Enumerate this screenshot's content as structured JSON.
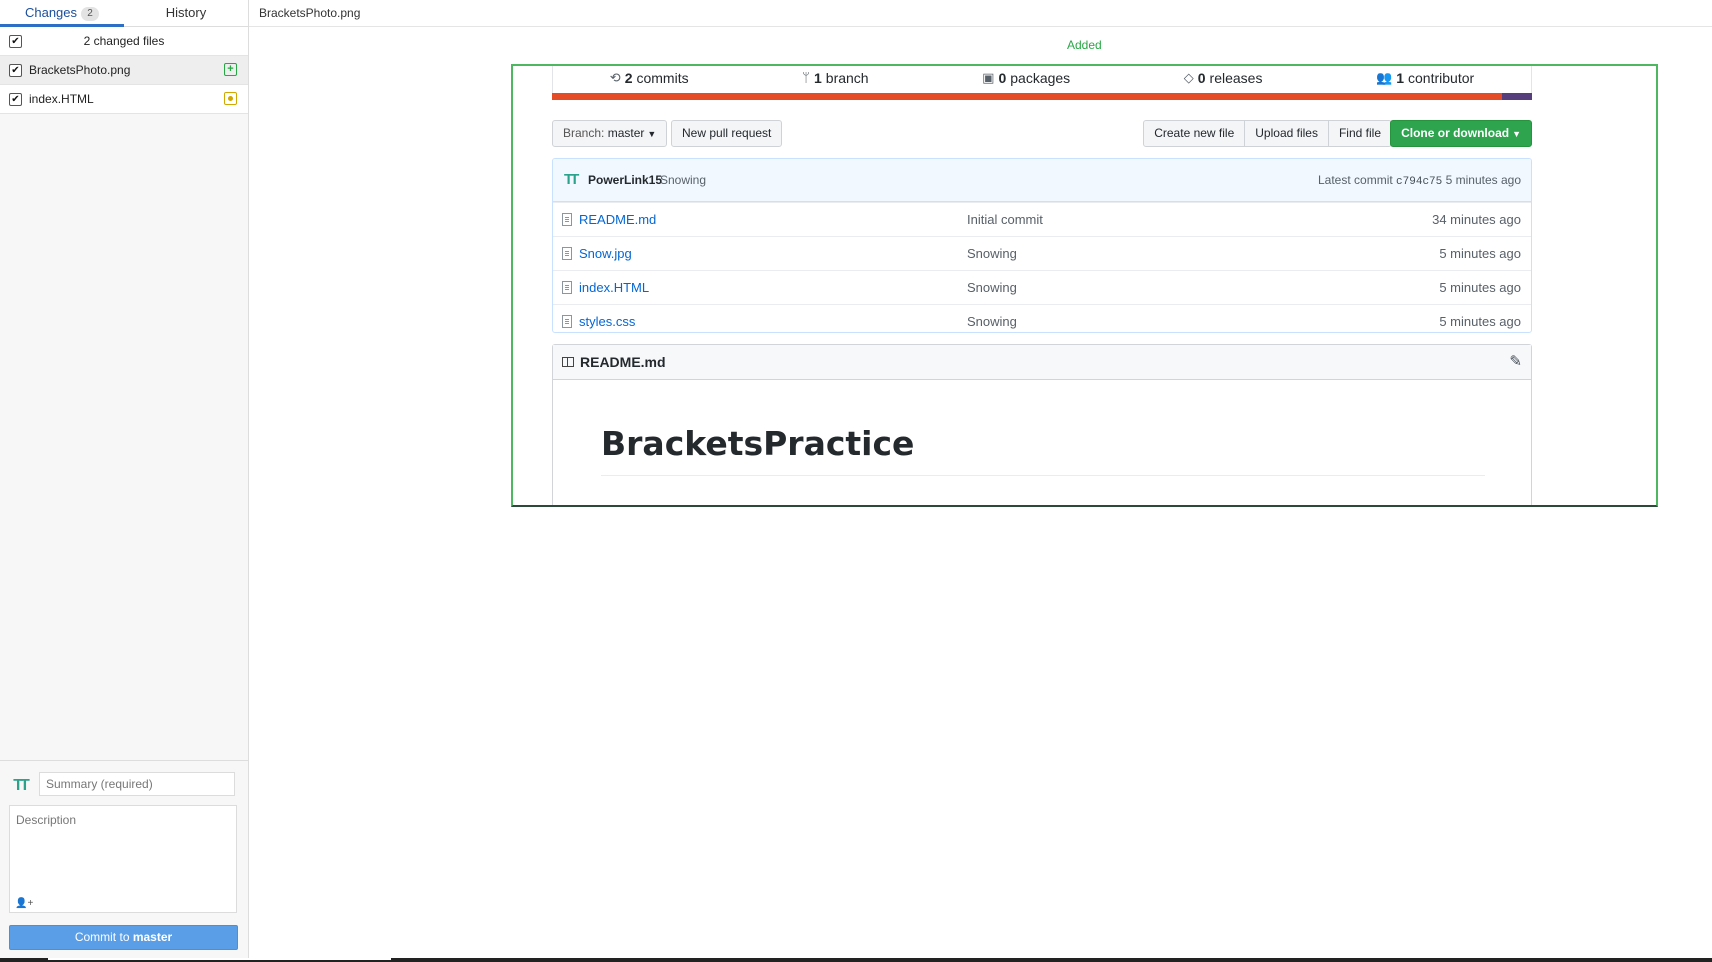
{
  "sidebar": {
    "tabs": [
      {
        "label": "Changes",
        "count": "2"
      },
      {
        "label": "History"
      }
    ],
    "changed_files_header": "2 changed files",
    "files": [
      {
        "name": "BracketsPhoto.png",
        "status": "added"
      },
      {
        "name": "index.HTML",
        "status": "modified"
      }
    ],
    "commit": {
      "summary_placeholder": "Summary (required)",
      "description_placeholder": "Description",
      "button_prefix": "Commit to ",
      "branch": "master"
    }
  },
  "main": {
    "file_title": "BracketsPhoto.png",
    "diff_status": "Added",
    "preview": {
      "stats": [
        {
          "icon": "history-icon",
          "count": "2",
          "label": "commits"
        },
        {
          "icon": "branch-icon",
          "count": "1",
          "label": "branch"
        },
        {
          "icon": "package-icon",
          "count": "0",
          "label": "packages"
        },
        {
          "icon": "tag-icon",
          "count": "0",
          "label": "releases"
        },
        {
          "icon": "people-icon",
          "count": "1",
          "label": "contributor"
        }
      ],
      "language_colors": {
        "html": "#e34c26",
        "css": "#563d7c"
      },
      "branch_button": {
        "prefix": "Branch:",
        "value": "master"
      },
      "new_pr_button": "New pull request",
      "file_buttons": [
        "Create new file",
        "Upload files",
        "Find file"
      ],
      "clone_button": "Clone or download",
      "latest_commit": {
        "author": "PowerLink15",
        "message": "Snowing",
        "label": "Latest commit",
        "sha": "c794c75",
        "age": "5 minutes ago"
      },
      "files": [
        {
          "name": "README.md",
          "message": "Initial commit",
          "age": "34 minutes ago"
        },
        {
          "name": "Snow.jpg",
          "message": "Snowing",
          "age": "5 minutes ago"
        },
        {
          "name": "index.HTML",
          "message": "Snowing",
          "age": "5 minutes ago"
        },
        {
          "name": "styles.css",
          "message": "Snowing",
          "age": "5 minutes ago"
        }
      ],
      "readme": {
        "title": "README.md",
        "heading": "BracketsPractice"
      }
    }
  },
  "colors": {
    "accent": "#2e6fc6",
    "added": "#28a745",
    "modified": "#d2a800",
    "clone_green": "#2ea44f",
    "frame": "#4db860"
  }
}
